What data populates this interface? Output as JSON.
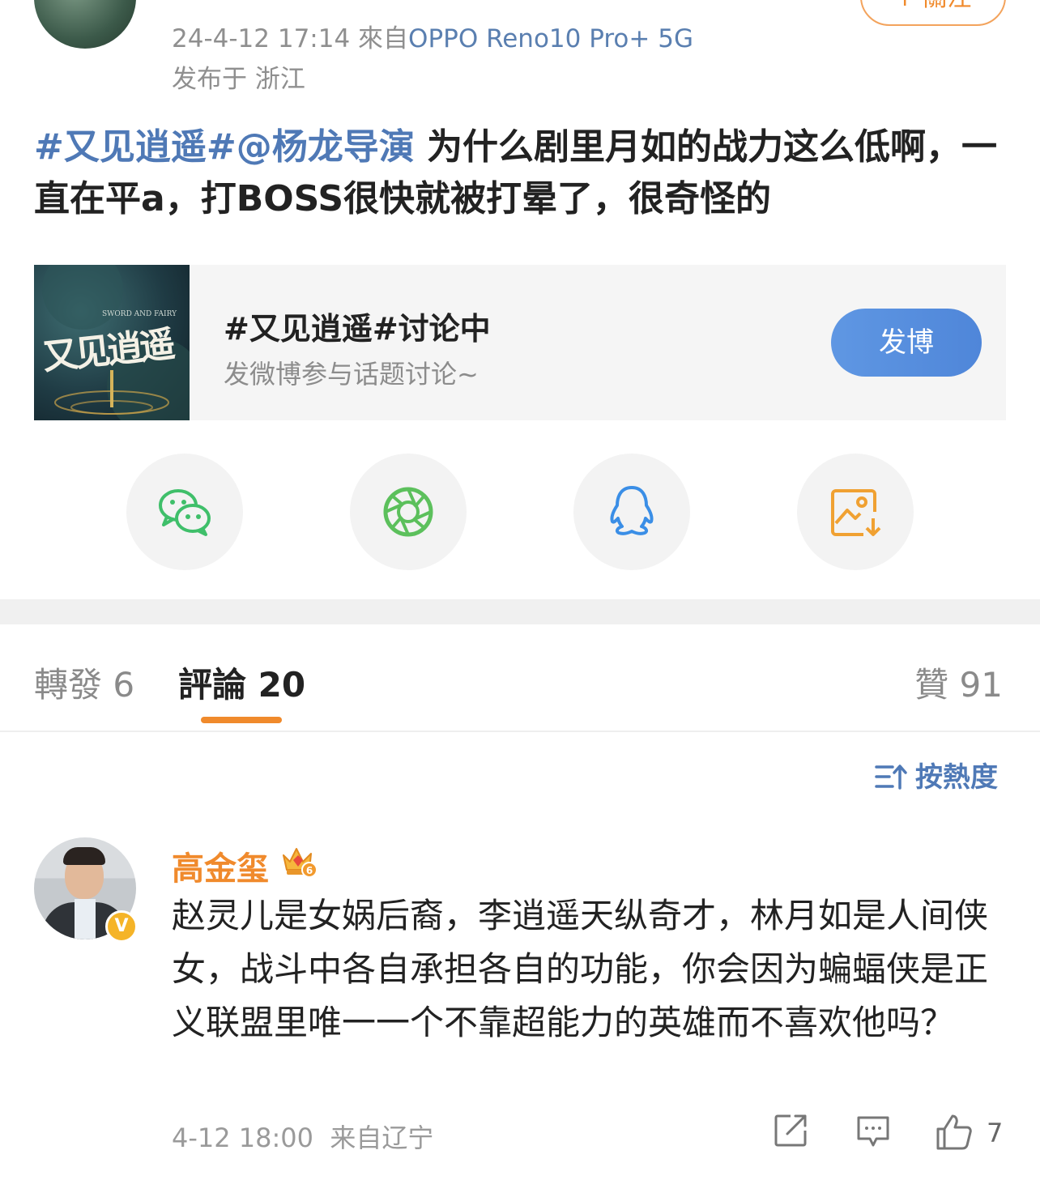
{
  "header": {
    "follow_label": "+ 關注",
    "timestamp": "24-4-12 17:14",
    "source_prefix": "來自",
    "device": "OPPO Reno10 Pro+ 5G",
    "location": "发布于 浙江"
  },
  "post": {
    "topic_link": "#又见逍遥#",
    "mention_link": "@杨龙导演",
    "body": " 为什么剧里月如的战力这么低啊，一直在平a，打BOSS很快就被打晕了，很奇怪的"
  },
  "topic_card": {
    "cover_calligraphy": "又见逍遥",
    "cover_subtitle": "SWORD AND FAIRY",
    "title": "#又见逍遥#讨论中",
    "subtitle": "发微博参与话题讨论~",
    "button_label": "发博"
  },
  "share": {
    "items": [
      {
        "icon": "wechat-icon",
        "color": "#3fbf6a"
      },
      {
        "icon": "moments-icon",
        "color": "#5cc05c"
      },
      {
        "icon": "qq-icon",
        "color": "#3a8ee6"
      },
      {
        "icon": "save-image-icon",
        "color": "#f0a132"
      }
    ]
  },
  "tabs": {
    "repost": "轉發 6",
    "comments": "評論 20",
    "likes": "贊 91"
  },
  "sort": {
    "label": "按熱度"
  },
  "comment": {
    "user": "高金玺",
    "crown_level": "6",
    "verified": "V",
    "text": "赵灵儿是女娲后裔，李逍遥天纵奇才，林月如是人间侠女，战斗中各自承担各自的功能，你会因为蝙蝠侠是正义联盟里唯一一个不靠超能力的英雄而不喜欢他吗？",
    "time": "4-12 18:00",
    "location": "来自辽宁",
    "like_count": "7"
  },
  "colors": {
    "accent_orange": "#f08a2c",
    "link_blue": "#4f79b6",
    "button_blue": "#5f97e3"
  }
}
